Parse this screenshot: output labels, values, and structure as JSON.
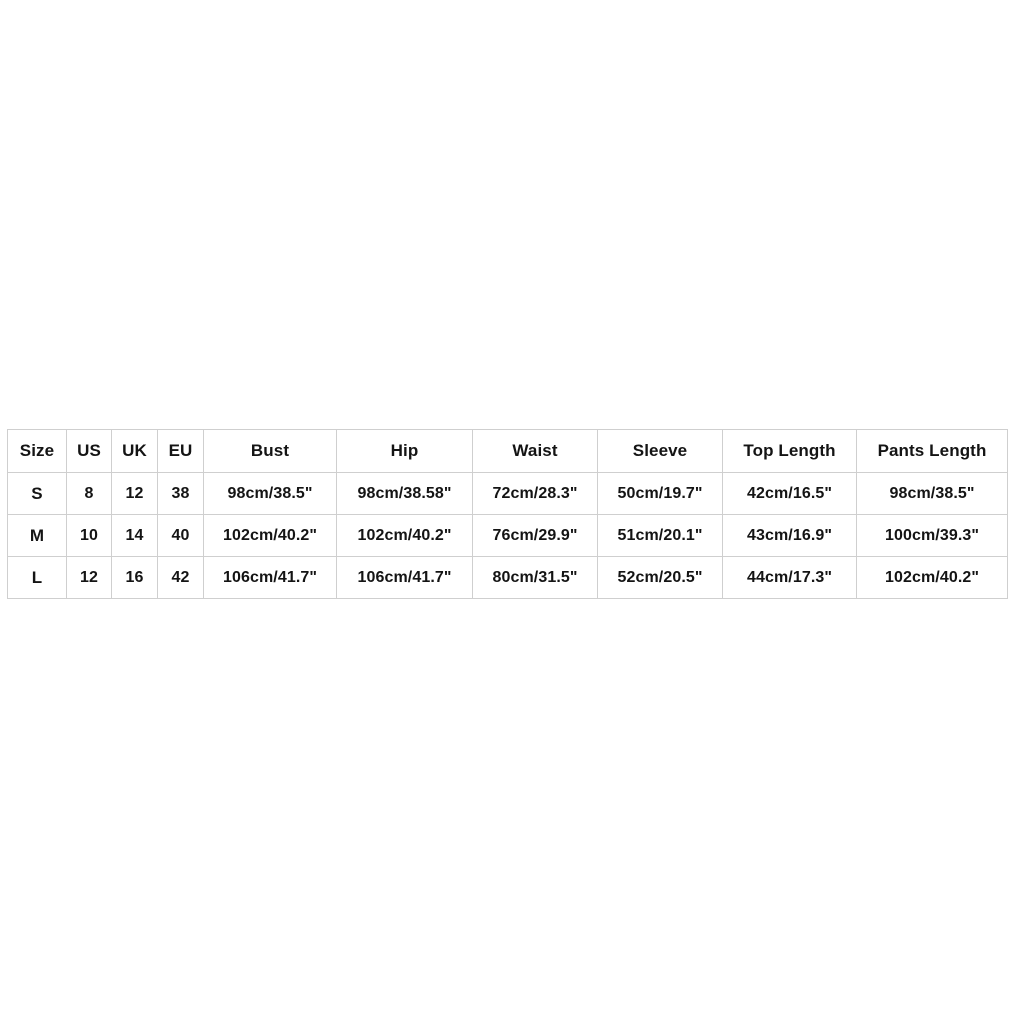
{
  "chart_data": {
    "type": "table",
    "title": "",
    "columns": [
      "Size",
      "US",
      "UK",
      "EU",
      "Bust",
      "Hip",
      "Waist",
      "Sleeve",
      "Top Length",
      "Pants Length"
    ],
    "rows": [
      {
        "size": "S",
        "us": "8",
        "uk": "12",
        "eu": "38",
        "bust": "98cm/38.5\"",
        "hip": "98cm/38.58\"",
        "waist": "72cm/28.3\"",
        "sleeve": "50cm/19.7\"",
        "top_length": "42cm/16.5\"",
        "pants_length": "98cm/38.5\""
      },
      {
        "size": "M",
        "us": "10",
        "uk": "14",
        "eu": "40",
        "bust": "102cm/40.2\"",
        "hip": "102cm/40.2\"",
        "waist": "76cm/29.9\"",
        "sleeve": "51cm/20.1\"",
        "top_length": "43cm/16.9\"",
        "pants_length": "100cm/39.3\""
      },
      {
        "size": "L",
        "us": "12",
        "uk": "16",
        "eu": "42",
        "bust": "106cm/41.7\"",
        "hip": "106cm/41.7\"",
        "waist": "80cm/31.5\"",
        "sleeve": "52cm/20.5\"",
        "top_length": "44cm/17.3\"",
        "pants_length": "102cm/40.2\""
      }
    ]
  },
  "table": {
    "headers": {
      "size": "Size",
      "us": "US",
      "uk": "UK",
      "eu": "EU",
      "bust": "Bust",
      "hip": "Hip",
      "waist": "Waist",
      "sleeve": "Sleeve",
      "top_length": "Top Length",
      "pants_length": "Pants Length"
    },
    "rows": [
      {
        "size": "S",
        "us": "8",
        "uk": "12",
        "eu": "38",
        "bust": "98cm/38.5\"",
        "hip": "98cm/38.58\"",
        "waist": "72cm/28.3\"",
        "sleeve": "50cm/19.7\"",
        "top_length": "42cm/16.5\"",
        "pants_length": "98cm/38.5\""
      },
      {
        "size": "M",
        "us": "10",
        "uk": "14",
        "eu": "40",
        "bust": "102cm/40.2\"",
        "hip": "102cm/40.2\"",
        "waist": "76cm/29.9\"",
        "sleeve": "51cm/20.1\"",
        "top_length": "43cm/16.9\"",
        "pants_length": "100cm/39.3\""
      },
      {
        "size": "L",
        "us": "12",
        "uk": "16",
        "eu": "42",
        "bust": "106cm/41.7\"",
        "hip": "106cm/41.7\"",
        "waist": "80cm/31.5\"",
        "sleeve": "52cm/20.5\"",
        "top_length": "44cm/17.3\"",
        "pants_length": "102cm/40.2\""
      }
    ]
  },
  "colors": {
    "background": "#ffffff",
    "border": "#cfcfcf",
    "text": "#141414"
  }
}
